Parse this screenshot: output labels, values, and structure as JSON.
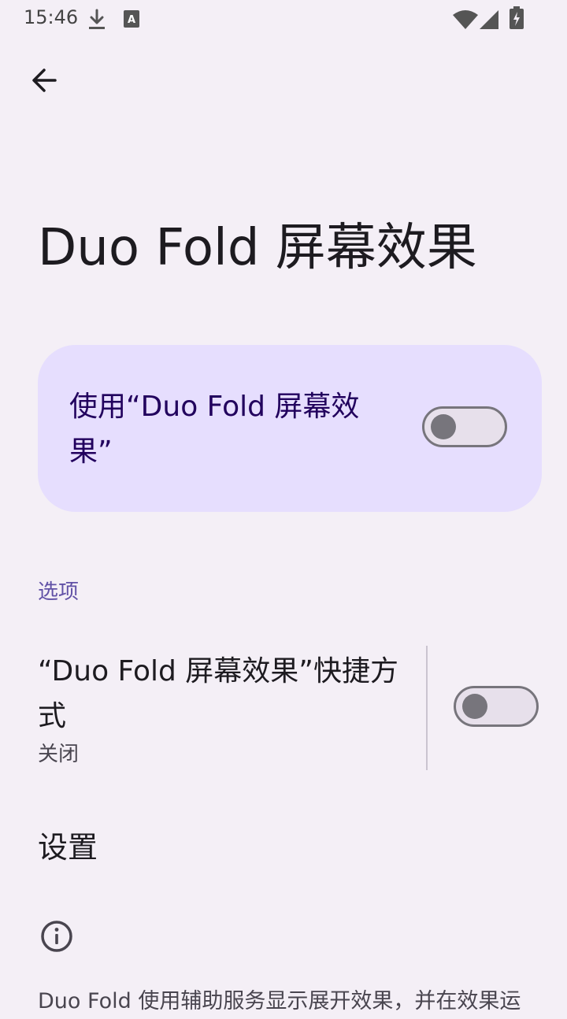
{
  "status_bar": {
    "time": "15:46",
    "icons": [
      "download-icon",
      "keyboard-a-icon",
      "wifi-icon",
      "signal-icon",
      "battery-charging-icon"
    ]
  },
  "header": {
    "back_icon": "arrow-left-icon"
  },
  "page": {
    "title": "Duo Fold 屏幕效果"
  },
  "main_switch": {
    "label": "使用“Duo Fold 屏幕效果”",
    "checked": false
  },
  "options_section": {
    "header": "选项",
    "shortcut": {
      "title": "“Duo Fold 屏幕效果”快捷方式",
      "summary": "关闭",
      "checked": false
    }
  },
  "settings": {
    "label": "设置"
  },
  "footer": {
    "icon": "info-icon",
    "text": "Duo Fold 使用辅助服务显示展开效果，并在效果运"
  },
  "colors": {
    "background": "#f4eff6",
    "card": "#e6defe",
    "accent": "#6151a6",
    "switch_off": "#77757c"
  }
}
